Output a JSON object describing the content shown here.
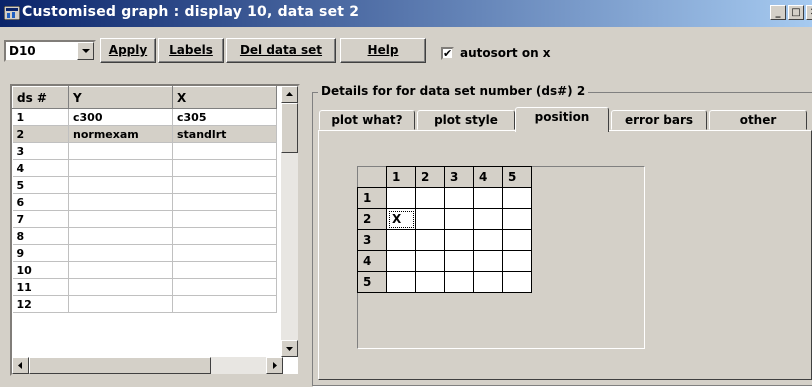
{
  "window": {
    "title": "Customised graph : display 10, data set 2"
  },
  "toolbar": {
    "display_value": "D10",
    "apply_label": "Apply",
    "labels_label": "Labels",
    "del_label": "Del data set",
    "help_label": "Help",
    "autosort_label": "autosort on x",
    "autosort_checked_mark": "✔"
  },
  "table": {
    "headers": [
      "ds #",
      "Y",
      "X"
    ],
    "rows": [
      [
        "1",
        "c300",
        "c305"
      ],
      [
        "2",
        "normexam",
        "standlrt"
      ],
      [
        "3",
        "",
        ""
      ],
      [
        "4",
        "",
        ""
      ],
      [
        "5",
        "",
        ""
      ],
      [
        "6",
        "",
        ""
      ],
      [
        "7",
        "",
        ""
      ],
      [
        "8",
        "",
        ""
      ],
      [
        "9",
        "",
        ""
      ],
      [
        "10",
        "",
        ""
      ],
      [
        "11",
        "",
        ""
      ],
      [
        "12",
        "",
        ""
      ]
    ],
    "selected_row": 2
  },
  "details": {
    "frame_label": "Details for for data set number (ds#) 2",
    "tabs": [
      "plot what?",
      "plot style",
      "position",
      "error bars",
      "other"
    ],
    "active_tab": "position"
  },
  "position_grid": {
    "col_headers": [
      "1",
      "2",
      "3",
      "4",
      "5"
    ],
    "row_headers": [
      "1",
      "2",
      "3",
      "4",
      "5"
    ],
    "marked_row": 2,
    "marked_col": 1,
    "mark": "X"
  }
}
